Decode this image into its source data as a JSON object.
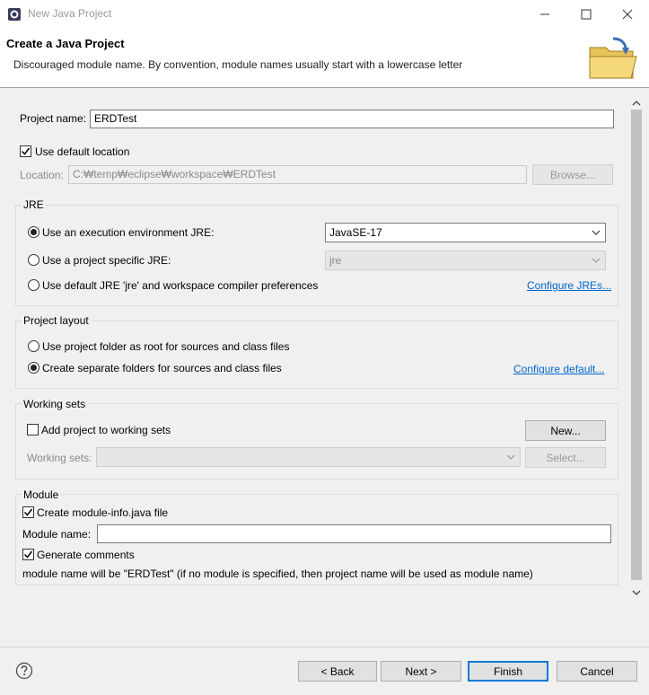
{
  "window": {
    "title": "New Java Project"
  },
  "header": {
    "title": "Create a Java Project",
    "message": "Discouraged module name. By convention, module names usually start with a lowercase letter",
    "image_icon": "folder-wizard-icon"
  },
  "project": {
    "name_label": "Project name:",
    "name_value": "ERDTest",
    "use_default_location_label": "Use default location",
    "use_default_location_checked": true,
    "location_label": "Location:",
    "location_value": "C:₩temp₩eclipse₩workspace₩ERDTest",
    "browse_label": "Browse..."
  },
  "jre": {
    "group_title": "JRE",
    "options": [
      {
        "label": "Use an execution environment JRE:",
        "selected": true
      },
      {
        "label": "Use a project specific JRE:",
        "selected": false
      },
      {
        "label": "Use default JRE 'jre' and workspace compiler preferences",
        "selected": false
      }
    ],
    "exec_env_value": "JavaSE-17",
    "specific_jre_value": "jre",
    "configure_link": "Configure JREs..."
  },
  "layout": {
    "group_title": "Project layout",
    "options": [
      {
        "label": "Use project folder as root for sources and class files",
        "selected": false
      },
      {
        "label": "Create separate folders for sources and class files",
        "selected": true
      }
    ],
    "configure_link": "Configure default..."
  },
  "working_sets": {
    "group_title": "Working sets",
    "add_label": "Add project to working sets",
    "add_checked": false,
    "new_button": "New...",
    "sets_label": "Working sets:",
    "select_button": "Select..."
  },
  "module": {
    "group_title": "Module",
    "create_label": "Create module-info.java file",
    "create_checked": true,
    "name_label": "Module name:",
    "name_value": "",
    "comments_label": "Generate comments",
    "comments_checked": true,
    "info_text": "module name will be \"ERDTest\"  (if no module is specified, then project name will be used as module name)"
  },
  "buttons": {
    "back": "< Back",
    "next": "Next >",
    "finish": "Finish",
    "cancel": "Cancel"
  },
  "colors": {
    "accent": "#0078d7",
    "link": "#0066cc"
  }
}
